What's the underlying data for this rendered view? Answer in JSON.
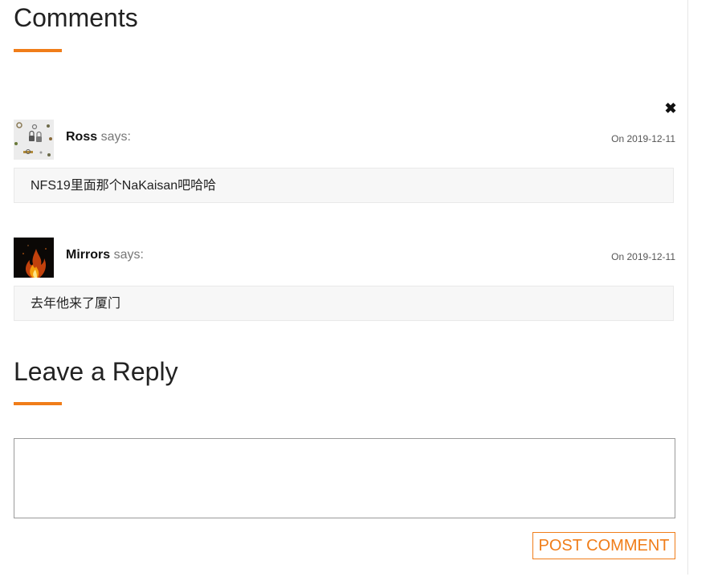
{
  "comments_section": {
    "title": "Comments",
    "close_glyph": "✖",
    "close_icon": "close-icon",
    "accent_color": "#f07d19",
    "items": [
      {
        "author": "Ross",
        "says": "says:",
        "date": "On 2019-12-11",
        "body": "NFS19里面那个NaKaisan吧哈哈",
        "avatar_icon": "padlocks-avatar"
      },
      {
        "author": "Mirrors",
        "says": "says:",
        "date": "On 2019-12-11",
        "body": "去年他来了厦门",
        "avatar_icon": "fire-avatar"
      }
    ]
  },
  "reply_section": {
    "title": "Leave a Reply",
    "textarea_value": "",
    "textarea_placeholder": "",
    "submit_label": "POST COMMENT"
  }
}
